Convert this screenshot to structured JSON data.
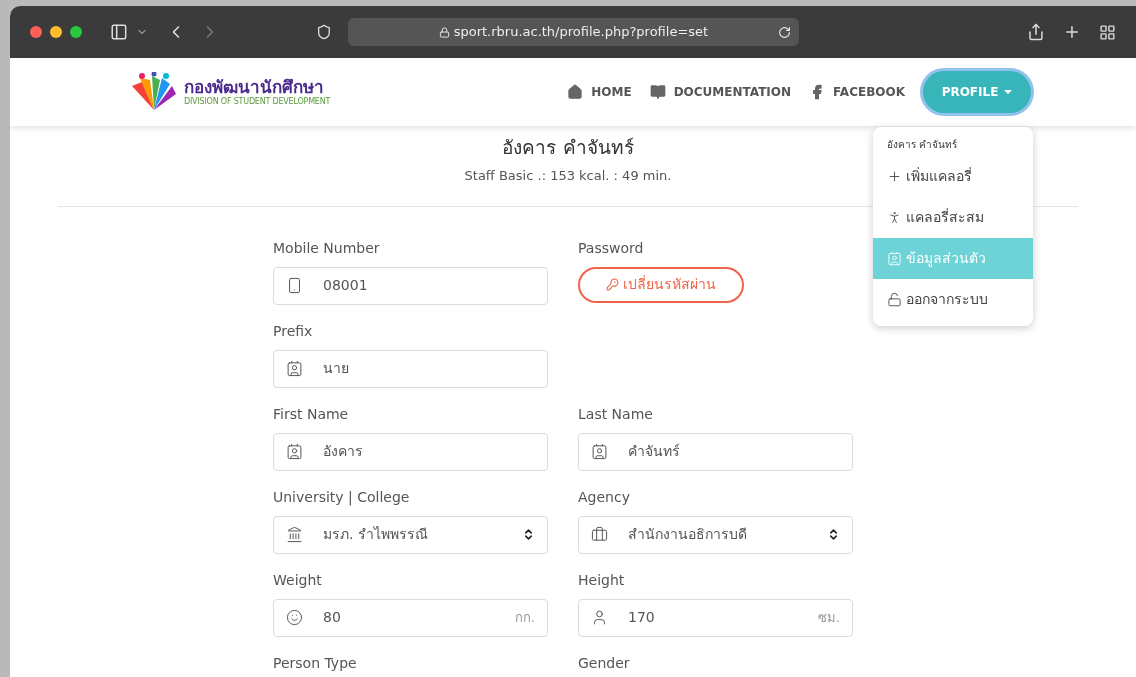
{
  "browser": {
    "url": "sport.rbru.ac.th/profile.php?profile=set"
  },
  "nav": {
    "logo_title": "กองพัฒนานักศึกษา",
    "logo_subtitle": "DIVISION OF STUDENT DEVELOPMENT",
    "items": [
      {
        "label": "HOME"
      },
      {
        "label": "DOCUMENTATION"
      },
      {
        "label": "FACEBOOK"
      }
    ],
    "profile_button": "PROFILE"
  },
  "profile": {
    "name": "อังคาร คำจันทร์",
    "summary": "Staff Basic .: 153 kcal. : 49 min."
  },
  "form_rows": [
    [
      {
        "label": "Mobile Number",
        "kind": "input",
        "value": "08001"
      },
      {
        "label": "Password",
        "kind": "button",
        "value": "เปลี่ยนรหัสผ่าน"
      }
    ],
    [
      {
        "label": "Prefix",
        "kind": "input",
        "value": "นาย"
      }
    ],
    [
      {
        "label": "First Name",
        "kind": "input",
        "value": "อังคาร"
      },
      {
        "label": "Last Name",
        "kind": "input",
        "value": "คำจันทร์"
      }
    ],
    [
      {
        "label": "University | College",
        "kind": "select",
        "value": "มรภ. รำไพพรรณี"
      },
      {
        "label": "Agency",
        "kind": "select",
        "value": "สำนักงานอธิการบดี"
      }
    ],
    [
      {
        "label": "Weight",
        "kind": "input",
        "value": "80",
        "unit": "กก."
      },
      {
        "label": "Height",
        "kind": "input",
        "value": "170",
        "unit": "ซม."
      }
    ],
    [
      {
        "label": "Person Type"
      },
      {
        "label": "Gender"
      }
    ]
  ],
  "dropdown": {
    "header": "อังคาร คำจันทร์",
    "items": [
      {
        "label": "เพิ่มแคลอรี่",
        "selected": false
      },
      {
        "label": "แคลอรี่สะสม",
        "selected": false
      },
      {
        "label": "ข้อมูลส่วนตัว",
        "selected": true
      },
      {
        "label": "ออกจากระบบ",
        "selected": false
      }
    ]
  }
}
